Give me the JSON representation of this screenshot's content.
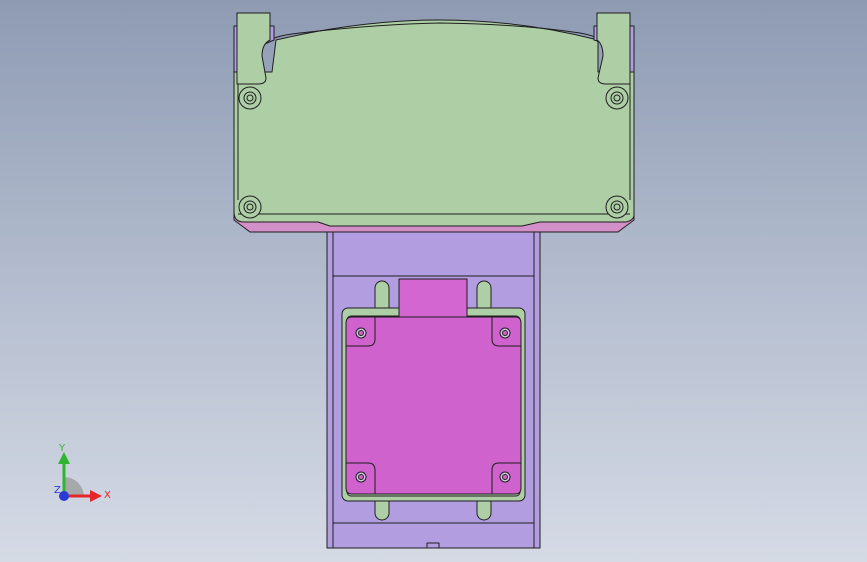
{
  "viewport": {
    "background_top": "#8e9bb3",
    "background_bottom": "#d5dae5"
  },
  "model": {
    "colors": {
      "green_body": "#aecfa6",
      "lilac_plate": "#b29de0",
      "magenta_block": "#d366d0",
      "pink_base": "#d38fc8",
      "edge": "#1e1e1e"
    },
    "parts": [
      "top-cover",
      "side-clamp-left",
      "side-clamp-right",
      "mounting-screw",
      "slide-plate",
      "motor-flange",
      "motor-block",
      "connector-block",
      "guide-slot"
    ]
  },
  "triad": {
    "x_label": "X",
    "y_label": "Y",
    "z_label": "Z",
    "x_color": "#e8262a",
    "y_color": "#2fb52f",
    "z_color": "#2a3ad6"
  }
}
